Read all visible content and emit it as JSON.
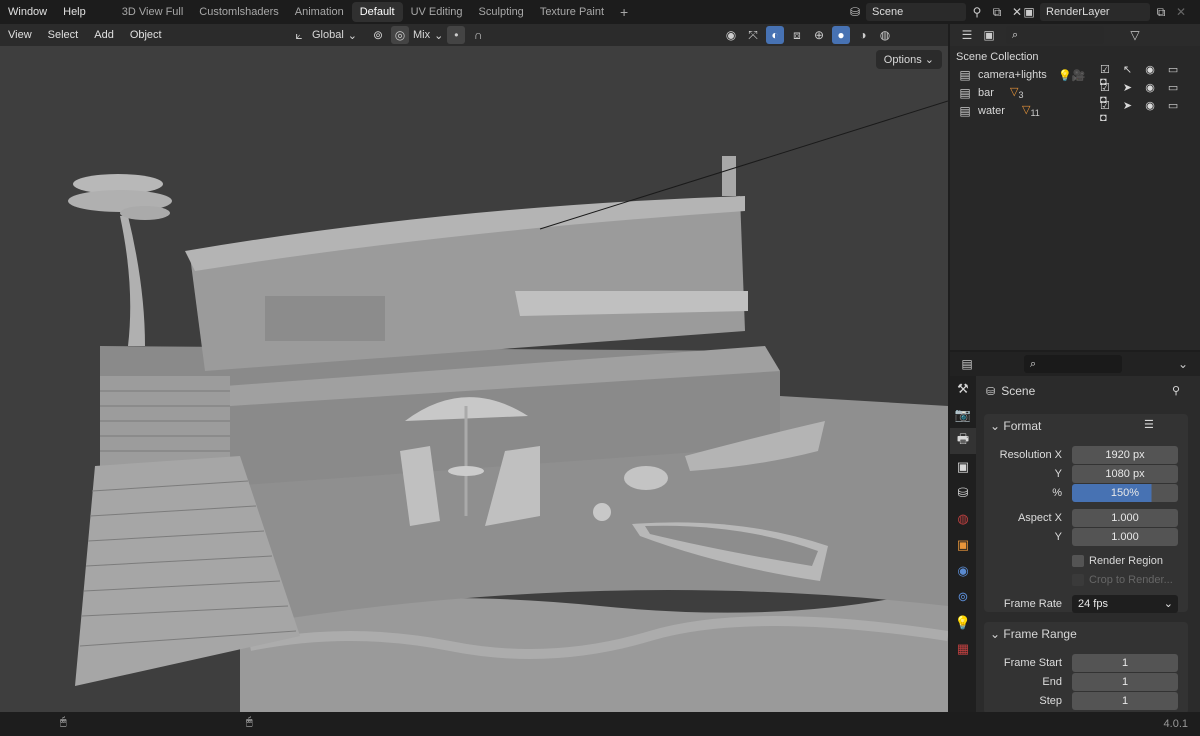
{
  "topbar": {
    "menus": [
      "Window",
      "Help"
    ],
    "workspaces": [
      "3D View Full",
      "Customlshaders",
      "Animation",
      "Default",
      "UV Editing",
      "Sculpting",
      "Texture Paint"
    ],
    "active_workspace": "Default",
    "add_tab": "+",
    "scene": "Scene",
    "view_layer": "RenderLayer"
  },
  "viewport_header": {
    "menus": [
      "View",
      "Select",
      "Add",
      "Object"
    ],
    "orientation": "Global",
    "proportional": "Mix",
    "options": "Options"
  },
  "outliner": {
    "root": "Scene Collection",
    "collections": [
      {
        "name": "camera+lights"
      },
      {
        "name": "bar",
        "count": "3"
      },
      {
        "name": "water",
        "count": "11"
      }
    ]
  },
  "properties": {
    "context": "Scene",
    "format": {
      "title": "Format",
      "resolution_x_label": "Resolution X",
      "resolution_x": "1920 px",
      "y_label": "Y",
      "resolution_y": "1080 px",
      "pct_label": "%",
      "percent": "150%",
      "percent_fill": 0.75,
      "aspect_x_label": "Aspect X",
      "aspect_x": "1.000",
      "aspect_y": "1.000",
      "render_region": "Render Region",
      "crop": "Crop to Render...",
      "frame_rate_label": "Frame Rate",
      "frame_rate": "24 fps"
    },
    "frame_range": {
      "title": "Frame Range",
      "start_label": "Frame Start",
      "start": "1",
      "end_label": "End",
      "end": "1",
      "step_label": "Step",
      "step": "1"
    }
  },
  "status": {
    "version": "4.0.1"
  },
  "colors": {
    "accent": "#4772b3",
    "orange": "#e8953a"
  }
}
